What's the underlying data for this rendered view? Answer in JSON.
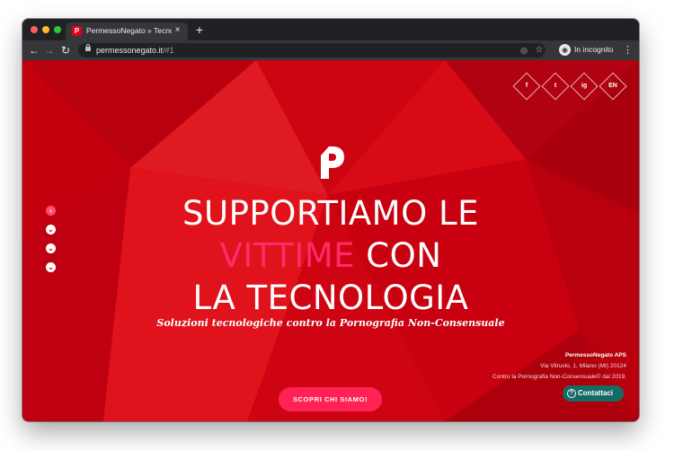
{
  "browser": {
    "tab": {
      "title": "PermessoNegato » Tecnologia",
      "favicon_letter": "P"
    },
    "new_tab_symbol": "+",
    "url": {
      "host": "permessonegato.it",
      "path": "/#1"
    },
    "incognito_label": "In incognito",
    "icons": {
      "back": "arrow-left-icon",
      "forward": "arrow-right-icon",
      "reload": "reload-icon",
      "lock": "lock-icon",
      "eye_off": "eye-off-icon",
      "star": "star-icon",
      "incognito": "incognito-icon",
      "menu": "kebab-menu-icon"
    }
  },
  "social": [
    {
      "name": "facebook",
      "label": "f"
    },
    {
      "name": "twitter",
      "label": "t"
    },
    {
      "name": "instagram",
      "label": "ig"
    },
    {
      "name": "language",
      "label": "EN"
    }
  ],
  "hero": {
    "headline_line1": "SUPPORTIAMO LE",
    "headline_highlight": "VITTIME",
    "headline_line2_rest": " CON",
    "headline_line3": "LA TECNOLOGIA",
    "subtitle": "Soluzioni tecnologiche contro la Pornografia Non-Consensuale",
    "cta_label": "SCOPRI CHI SIAMO!"
  },
  "org": {
    "name": "PermessoNegato APS",
    "address": "Via Vitruvio, 1, Milano (MI) 20124",
    "tagline": "Contro la Pornografia Non-Consensuale© dal 2019."
  },
  "contact_label": "Contattaci",
  "colors": {
    "page_red": "#d30010",
    "highlight_pink": "#ff2a68",
    "cta_pink": "#ff2255",
    "contact_teal": "#146b64"
  }
}
